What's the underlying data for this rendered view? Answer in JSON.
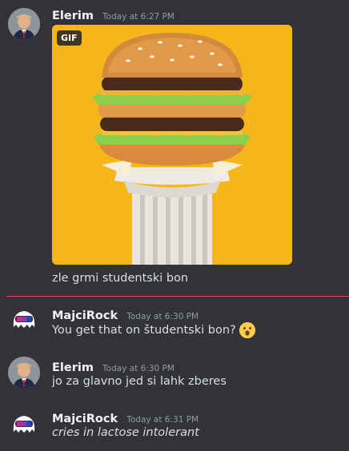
{
  "messages": [
    {
      "author": "Elerim",
      "timestamp": "Today at 6:27 PM",
      "gif_badge": "GIF",
      "text": "zle grmi studentski bon"
    },
    {
      "author": "MajciRock",
      "timestamp": "Today at 6:30 PM",
      "text": "You get that on študentski bon?",
      "emoji": "face-with-open-mouth"
    },
    {
      "author": "Elerim",
      "timestamp": "Today at 6:30 PM",
      "text": "jo za glavno jed si lahk zberes"
    },
    {
      "author": "MajciRock",
      "timestamp": "Today at 6:31 PM",
      "text": "cries in lactose intolerant"
    }
  ],
  "colors": {
    "background": "#313338",
    "new_divider": "#c0585d",
    "gif_background": "#f4b61b"
  }
}
